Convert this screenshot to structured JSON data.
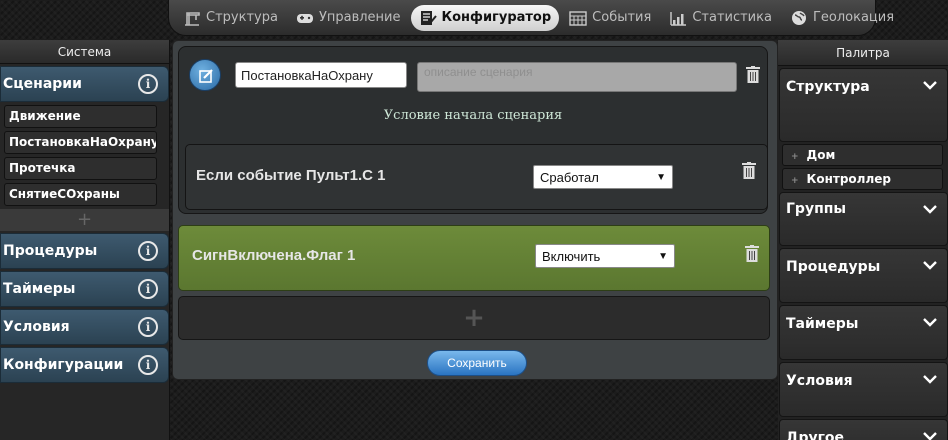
{
  "nav": {
    "items": [
      {
        "label": "Структура",
        "icon": "crane-icon",
        "active": false
      },
      {
        "label": "Управление",
        "icon": "gamepad-icon",
        "active": false
      },
      {
        "label": "Конфигуратор",
        "icon": "document-edit-icon",
        "active": true
      },
      {
        "label": "События",
        "icon": "calendar-icon",
        "active": false
      },
      {
        "label": "Статистика",
        "icon": "bar-chart-icon",
        "active": false
      },
      {
        "label": "Геолокация",
        "icon": "globe-icon",
        "active": false
      }
    ]
  },
  "left": {
    "title": "Система",
    "scenarios_label": "Сценарии",
    "scenarios": [
      "Движение",
      "ПостановкаНаОхрану",
      "Протечка",
      "СнятиеСОхраны"
    ],
    "add_symbol": "+",
    "sections": [
      "Процедуры",
      "Таймеры",
      "Условия",
      "Конфигурации"
    ],
    "info_symbol": "i"
  },
  "main": {
    "name_value": "ПостановкаНаОхрану",
    "description_placeholder": "описание сценария",
    "condition_title": "Условие начала сценария",
    "event_text": "Если событие Пульт1.С 1",
    "event_select": "Сработал",
    "action_text": "СигнВключена.Флаг 1",
    "action_select": "Включить",
    "add_symbol": "+",
    "save_label": "Сохранить"
  },
  "palette": {
    "title": "Палитра",
    "structure_label": "Структура",
    "structure_items": [
      "Дом",
      "Контроллер"
    ],
    "item_bullet": "+",
    "sections": [
      "Группы",
      "Процедуры",
      "Таймеры",
      "Условия",
      "Другое"
    ]
  },
  "colors": {
    "accent_blue": "#3e5a6f",
    "action_green": "#6d8b3a",
    "save_blue": "#2a74c2"
  }
}
